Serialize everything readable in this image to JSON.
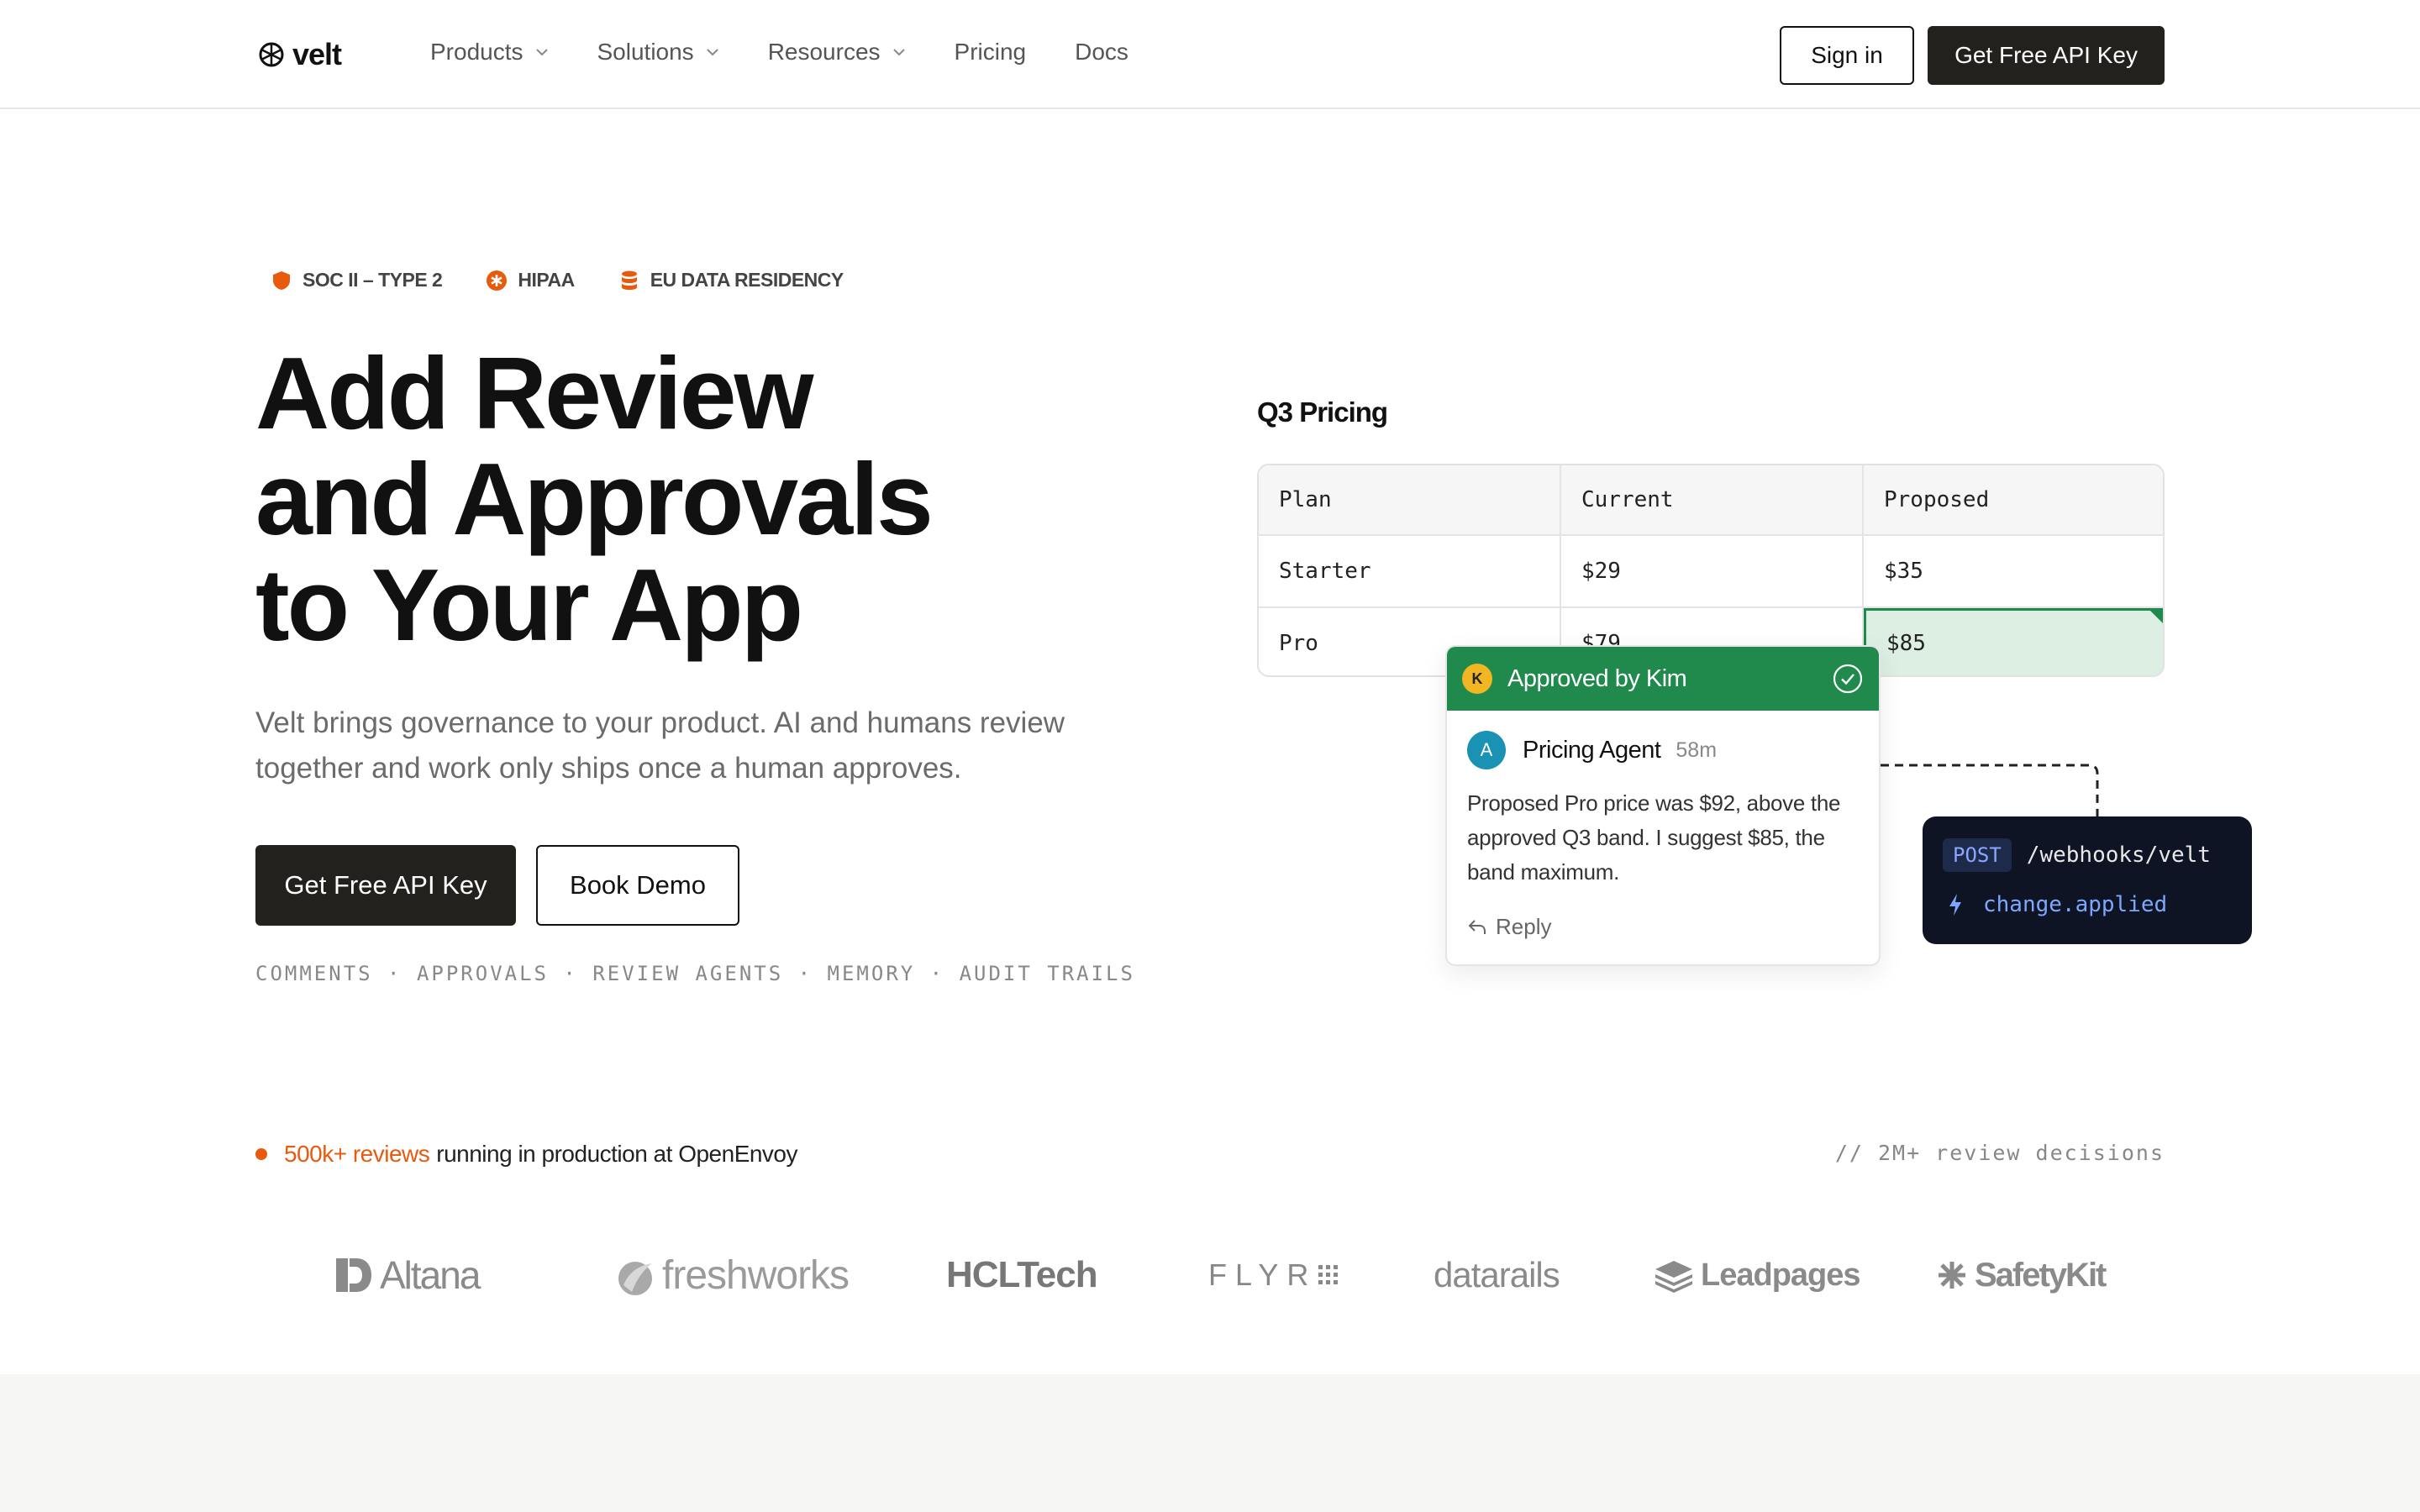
{
  "nav": {
    "logo_text": "velt",
    "links": [
      {
        "label": "Products",
        "has_dropdown": true
      },
      {
        "label": "Solutions",
        "has_dropdown": true
      },
      {
        "label": "Resources",
        "has_dropdown": true
      },
      {
        "label": "Pricing",
        "has_dropdown": false
      },
      {
        "label": "Docs",
        "has_dropdown": false
      }
    ],
    "sign_in": "Sign in",
    "cta": "Get Free API Key"
  },
  "badges": [
    {
      "label": "SOC II – TYPE 2",
      "icon": "shield-icon"
    },
    {
      "label": "HIPAA",
      "icon": "medical-icon"
    },
    {
      "label": "EU DATA RESIDENCY",
      "icon": "database-icon"
    }
  ],
  "hero": {
    "title_lines": [
      "Add Review",
      "and Approvals",
      "to Your App"
    ],
    "subtitle": "Velt brings governance to your product. AI and humans review together and work only ships once a human approves.",
    "primary_button": "Get Free API Key",
    "secondary_button": "Book Demo",
    "features": "COMMENTS · APPROVALS · REVIEW AGENTS · MEMORY · AUDIT TRAILS"
  },
  "pricing_demo": {
    "title": "Q3 Pricing",
    "headers": [
      "Plan",
      "Current",
      "Proposed"
    ],
    "rows": [
      [
        "Starter",
        "$29",
        "$35"
      ],
      [
        "Pro",
        "$79",
        "$85"
      ]
    ]
  },
  "comment": {
    "approver_initial": "K",
    "approved_label": "Approved by Kim",
    "author_initial": "A",
    "author": "Pricing Agent",
    "time": "58m",
    "body": "Proposed Pro price was $92, above the approved Q3 band. I suggest $85, the band maximum.",
    "reply": "Reply"
  },
  "webhook": {
    "method": "POST",
    "path": "/webhooks/velt",
    "event": "change.applied"
  },
  "stats": {
    "highlight": "500k+ reviews",
    "rest": "running in production at OpenEnvoy",
    "right": "// 2M+ review decisions"
  },
  "logos": [
    "Altana",
    "freshworks",
    "HCLTech",
    "FLYR",
    "datarails",
    "Leadpages",
    "SafetyKit"
  ],
  "colors": {
    "accent_orange": "#e85a0e",
    "approve_green": "#1f8a4c",
    "dark": "#22211d",
    "webhook_bg": "#0f1424"
  }
}
